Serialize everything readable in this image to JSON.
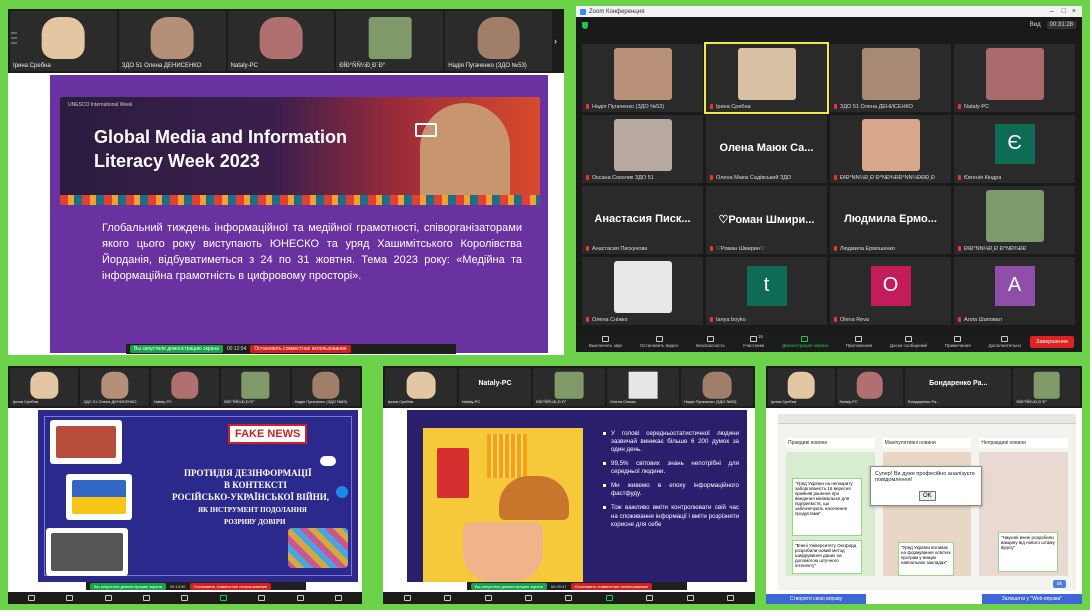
{
  "panel1": {
    "strip": [
      {
        "name": "Ірина Сребна"
      },
      {
        "name": "ЗДО 51 Олена ДЕНИСЕНКО"
      },
      {
        "name": "Nataly-PC"
      },
      {
        "name": "ÐÌÐ°ÑÑ¼Ð¸Ð´Ð°"
      },
      {
        "name": "Надія Пугаченко (ЗДО №53)"
      }
    ],
    "slide_brand": "UNESCO International Week",
    "slide_title_1": "Global Media and Information",
    "slide_title_2": "Literacy Week 2023",
    "slide_text": "Глобальний тиждень інформаційної та медійної грамотності, співорганізаторами якого цього року виступають ЮНЕСКО та уряд Хашимітського Королівства Йорданія, відбуватиметься з 24 по 31 жовтня. Тема 2023 року: «Медійна та інформаційна грамотність в цифровому просторі».",
    "share_status": "Вы запустили демонстрацию экрана",
    "time": "00:12:54",
    "stop_share": "Остановить совместное использование"
  },
  "panel2": {
    "title": "Zoom Конференция",
    "view_label": "Вид",
    "timer": "00:31:28",
    "tiles": [
      {
        "name": "Надія Пугаченко (ЗДО №53)",
        "kind": "photo",
        "color": "#b89077"
      },
      {
        "name": "Ірина Сребна",
        "kind": "photo",
        "color": "#d9c1a4",
        "active": true
      },
      {
        "name": "ЗДО 51 Олена ДЕНИСЕНКО",
        "kind": "photo",
        "color": "#a88a74"
      },
      {
        "name": "Nataly-PC",
        "kind": "photo",
        "color": "#a86a6a"
      },
      {
        "name": "Оксана Соколик ЗДО 51",
        "kind": "photo",
        "color": "#b7a9a0"
      },
      {
        "name": "Олена Маюк Садівський ЗДО",
        "kind": "text",
        "big": "Олена Маюк Са..."
      },
      {
        "name": "ÐÌÐ°ÑÑ¼Ð¸Ð´Ð°ÑÐ¾ÐÐ°ÑÑ¼ÐÐÐ¸Ð",
        "kind": "photo",
        "color": "#d6a78b"
      },
      {
        "name": "Євгенія Кіндра",
        "kind": "letter",
        "letter": "Є",
        "color": "#0e6b54"
      },
      {
        "name": "Анастасия Пискунова",
        "kind": "text",
        "big": "Анастасия Писк..."
      },
      {
        "name": "♡Роман Шмирин♡",
        "kind": "text",
        "big": "♡Роман Шмири..."
      },
      {
        "name": "Людмила Ермошенко",
        "kind": "text",
        "big": "Людмила Ермо..."
      },
      {
        "name": "ÐÌÐ°ÑÑ¼Ð¸Ð´Ð°ÑÐ¾ÐÐ",
        "kind": "photo",
        "color": "#7c9a6a"
      },
      {
        "name": "Олена Сніжко",
        "kind": "silhouette",
        "color": "#e8e8e8"
      },
      {
        "name": "tanya boyko",
        "kind": "letter",
        "letter": "t",
        "color": "#0e6b54"
      },
      {
        "name": "Olena Reva",
        "kind": "letter",
        "letter": "O",
        "color": "#c21d5a"
      },
      {
        "name": "Алла Шаповал",
        "kind": "letter",
        "letter": "A",
        "color": "#8f4ea8"
      }
    ],
    "toolbar": [
      {
        "label": "Выключить звук"
      },
      {
        "label": "Остановить видео"
      },
      {
        "label": "Безопасность"
      },
      {
        "label": "Участники",
        "count": "16"
      },
      {
        "label": "Демонстрация экрана"
      },
      {
        "label": "Приложения"
      },
      {
        "label": "Доски сообщений"
      },
      {
        "label": "Примечания"
      },
      {
        "label": "Дополнительно"
      }
    ],
    "end_label": "Завершение"
  },
  "panel3": {
    "strip": [
      {
        "name": "Ірина Сребна"
      },
      {
        "name": "ЗДО 51 Олена ДЕНИСЕНКО"
      },
      {
        "name": "Nataly-PC"
      },
      {
        "name": "ÐÌÐ°ÑÑ¼Ð¸Ð´Ð°"
      },
      {
        "name": "Надія Пугаченко (ЗДО №53)"
      }
    ],
    "fake_news": "FAKE NEWS",
    "title_1": "ПРОТИДІЯ ДЕЗІНФОРМАЦІЇ",
    "title_2": "В КОНТЕКСТІ",
    "title_3": "РОСІЙСЬКО-УКРАЇНСЬКОЇ ВІЙНИ,",
    "title_4": "ЯК ІНСТРУМЕНТ ПОДОЛАННЯ",
    "title_5": "РОЗРИВУ ДОВІРИ",
    "share_status": "Вы запустили демонстрацию экрана",
    "time": "00:13:30",
    "stop_share": "Остановить совместное использование"
  },
  "panel4": {
    "strip": [
      {
        "name": "Ірина Сребна"
      },
      {
        "name": "Nataly-PC"
      },
      {
        "name": "ÐÌÐ°ÑÑ¼Ð¸Ð´Ð°"
      },
      {
        "name": "Олена Сніжко"
      },
      {
        "name": "Надія Пугаченко (ЗДО №53)"
      }
    ],
    "strip_big": "Nataly-PC",
    "bullets": [
      "У голові середньостатистичної людини зазвичай виникає більше 6 200 думок за один день.",
      "99,5% світових знань непотрібні для середньої людини.",
      "Ми живемо в епоху інформаційного фастфуду.",
      "Тож важливо вміти контролювати свій час на споживання інформації і вміти розрізняти корисне для себе"
    ],
    "share_status": "Вы запустили демонстрацию экрана",
    "time": "00:29:47",
    "stop_share": "Остановить совместное использование"
  },
  "panel5": {
    "strip": [
      {
        "name": "Ірина Сребна"
      },
      {
        "name": "Nataly-PC"
      },
      {
        "name": "Бондаренко Ра..."
      },
      {
        "name": "ÐÌÐ°ÑÑ¼Ð¸Ð´Ð°"
      }
    ],
    "strip_big": "Бондаренко Ра...",
    "columns": [
      "Правдиві новини",
      "Маніпулятивні новини",
      "Неправдиві новини"
    ],
    "dialog_text": "Супер! Ви дуже професійно аналізуєте повідомлення!",
    "ok_label": "OK",
    "cards": [
      "\"Уряд України на непокриту заборгованість 16 вересня прийняв рішення про введення мінімальної для підприємств, що забезпечують населення продуктами\"",
      "\"Вчені Університету Оксфорд розробили новий метод шифрування даних на допомогою штучного інтелекту\"",
      "\"Уряд України впливає на формування освітніх програм у вищих навчальних закладах\"",
      "\"Наукові вчені розробили вакцину від нового штаму вірусу\""
    ],
    "ok_button": "ok",
    "bottom_left": "Створити свою вправу",
    "bottom_right": "Залишити у \"Web-вправи\""
  }
}
